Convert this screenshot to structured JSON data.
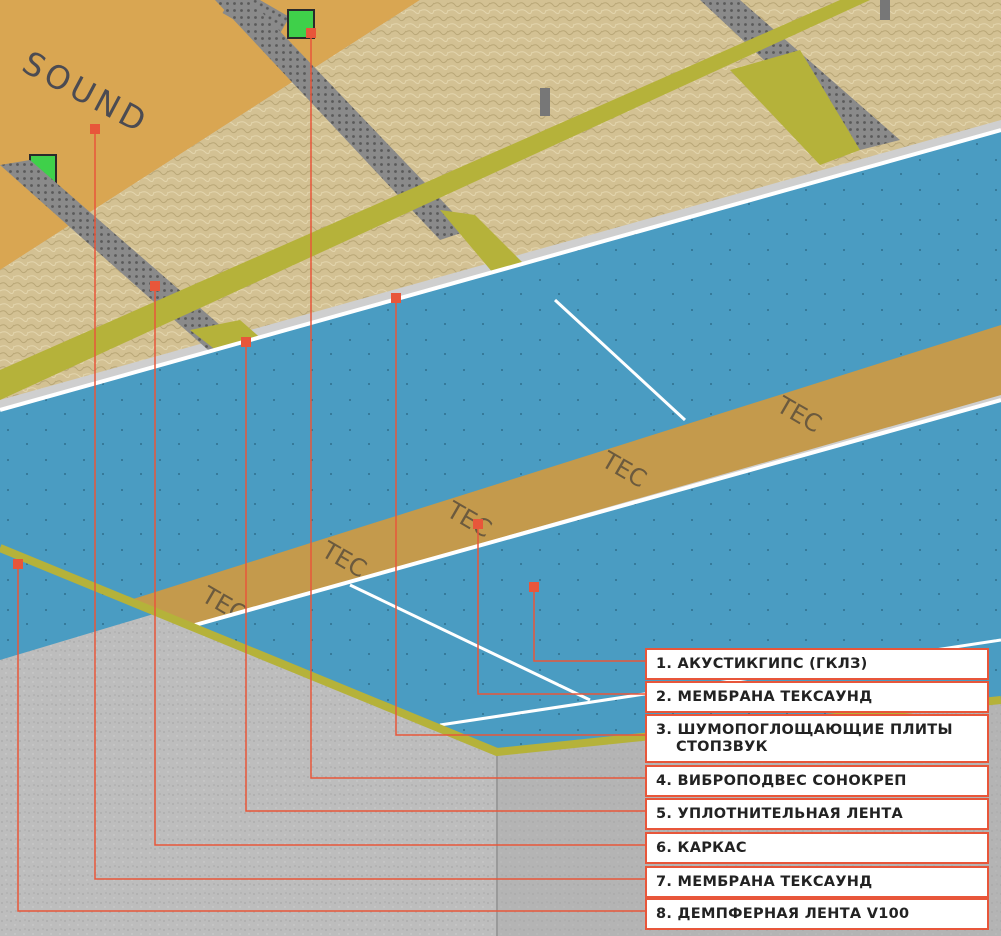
{
  "diagram": {
    "labels": [
      {
        "text": "1. АКУСТИКГИПС (ГКЛЗ)"
      },
      {
        "text": "2. МЕМБРАНА ТЕКСАУНД"
      },
      {
        "text": "3. ШУМОПОГЛОЩАЮЩИЕ ПЛИТЫ",
        "text2": "СТОПЗВУК"
      },
      {
        "text": "4. ВИБРОПОДВЕС СОНОКРЕП"
      },
      {
        "text": "5. УПЛОТНИТЕЛЬНАЯ ЛЕНТА"
      },
      {
        "text": "6. КАРКАС"
      },
      {
        "text": "7. МЕМБРАНА ТЕКСАУНД"
      },
      {
        "text": "8. ДЕМПФЕРНАЯ ЛЕНТА V100"
      }
    ],
    "membrane_prints": [
      "TEC",
      "TEC",
      "TEC",
      "TEC",
      "TEC"
    ],
    "top_brand_print": "SOUND",
    "colors": {
      "leader": "#e8563a",
      "drywall": "#4a9cc2",
      "membrane": "#c49a4c",
      "mineral_wool": "#d3c193",
      "profile": "#b5b23a",
      "concrete": "#bcbcbc"
    }
  }
}
